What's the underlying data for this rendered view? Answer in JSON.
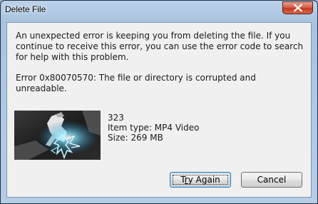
{
  "window": {
    "title": "Delete File"
  },
  "message": {
    "main": "An unexpected error is keeping you from deleting the file. If you continue to receive this error, you can use the error code to search for help with this problem.",
    "error": "Error 0x80070570: The file or directory is corrupted and unreadable."
  },
  "file": {
    "name": "323",
    "type_line": "Item type: MP4 Video",
    "size_line": "Size: 269 MB"
  },
  "buttons": {
    "try_again_first": "T",
    "try_again_underlined": "r",
    "try_again_rest": "y Again",
    "cancel": "Cancel"
  },
  "icons": {
    "close": "close-icon"
  }
}
